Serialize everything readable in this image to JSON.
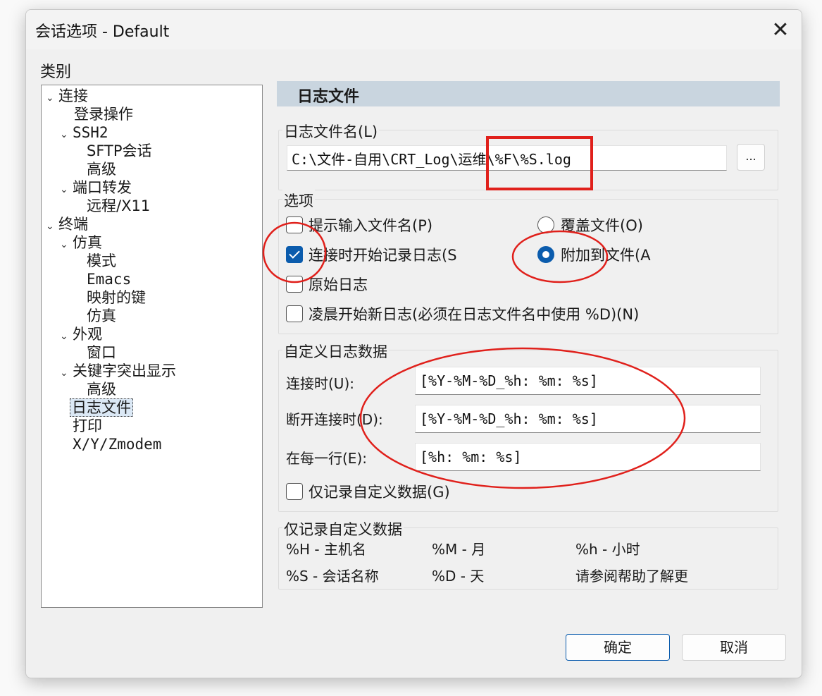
{
  "window": {
    "title": "会话选项 - Default",
    "close_glyph": "✕"
  },
  "category": {
    "label": "类别",
    "tree": [
      {
        "label": "连接",
        "expanded": true
      },
      {
        "label": "登录操作"
      },
      {
        "label": "SSH2",
        "expanded": true
      },
      {
        "label": "SFTP会话"
      },
      {
        "label": "高级"
      },
      {
        "label": "端口转发",
        "expanded": true
      },
      {
        "label": "远程/X11"
      },
      {
        "label": "终端",
        "expanded": true
      },
      {
        "label": "仿真",
        "expanded": true
      },
      {
        "label": "模式"
      },
      {
        "label": "Emacs"
      },
      {
        "label": "映射的键"
      },
      {
        "label": "仿真"
      },
      {
        "label": "外观",
        "expanded": true
      },
      {
        "label": "窗口"
      },
      {
        "label": "关键字突出显示",
        "expanded": true
      },
      {
        "label": "高级"
      },
      {
        "label": "日志文件",
        "selected": true
      },
      {
        "label": "打印"
      },
      {
        "label": "X/Y/Zmodem"
      }
    ]
  },
  "panel": {
    "header": "日志文件",
    "log_filename": {
      "group_title": "日志文件名(L)",
      "value": "C:\\文件-自用\\CRT_Log\\运维\\%F\\%S.log",
      "browse_label": "..."
    },
    "options": {
      "group_title": "选项",
      "prompt_filename": {
        "label": "提示输入文件名(P)",
        "checked": false
      },
      "start_on_connect": {
        "label": "连接时开始记录日志(S",
        "checked": true
      },
      "raw_log": {
        "label": "原始日志",
        "checked": false
      },
      "new_log_midnight": {
        "label": "凌晨开始新日志(必须在日志文件名中使用 %D)(N)",
        "checked": false
      },
      "overwrite_file": {
        "label": "覆盖文件(O)",
        "selected": false
      },
      "append_file": {
        "label": "附加到文件(A",
        "selected": true
      }
    },
    "custom_log": {
      "group_title": "自定义日志数据",
      "on_connect_label": "连接时(U):",
      "on_connect_value": "[%Y-%M-%D_%h: %m: %s]",
      "on_disconnect_label": "断开连接时(D):",
      "on_disconnect_value": "[%Y-%M-%D_%h: %m: %s]",
      "each_line_label": "在每一行(E):",
      "each_line_value": "[%h: %m: %s]",
      "custom_only": {
        "label": "仅记录自定义数据(G)",
        "checked": false
      }
    },
    "legend": {
      "group_title": "仅记录自定义数据",
      "rows": [
        [
          "%H - 主机名",
          "%M - 月",
          "%h - 小时"
        ],
        [
          "%S - 会话名称",
          "%D - 天",
          "请参阅帮助了解更"
        ]
      ]
    }
  },
  "buttons": {
    "ok": "确定",
    "cancel": "取消"
  },
  "colors": {
    "accent": "#0b5cad",
    "annotation": "#e0201b",
    "header_bg": "#c9d5df"
  }
}
